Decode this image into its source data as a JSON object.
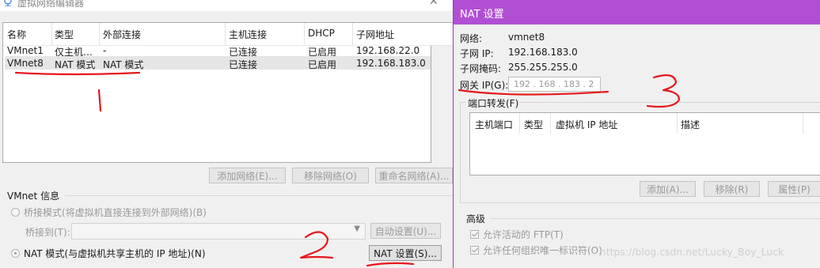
{
  "left_window": {
    "title": "虚拟网络编辑器",
    "table": {
      "columns": [
        "名称",
        "类型",
        "外部连接",
        "主机连接",
        "DHCP",
        "子网地址"
      ],
      "rows": [
        [
          "VMnet1",
          "仅主机…",
          "-",
          "已连接",
          "已启用",
          "192.168.22.0"
        ],
        [
          "VMnet8",
          "NAT 模式",
          "NAT 模式",
          "已连接",
          "已启用",
          "192.168.183.0"
        ]
      ],
      "selected_row": 1
    },
    "buttons": {
      "add": "添加网络(E)...",
      "remove": "移除网络(O)",
      "rename": "重命名网络(A)..."
    },
    "vmnet_info": {
      "section_label": "VMnet 信息",
      "bridged_radio": "桥接模式(将虚拟机直接连接到外部网络)(B)",
      "bridged_to_label": "桥接到(T):",
      "bridged_to_value": "",
      "auto_settings_button": "自动设置(U)...",
      "nat_radio": "NAT 模式(与虚拟机共享主机的 IP 地址)(N)",
      "nat_settings_button": "NAT 设置(S)..."
    }
  },
  "right_window": {
    "title": "NAT 设置",
    "network_label": "网络:",
    "network_value": "vmnet8",
    "subnet_ip_label": "子网 IP:",
    "subnet_ip_value": "192.168.183.0",
    "subnet_mask_label": "子网掩码:",
    "subnet_mask_value": "255.255.255.0",
    "gateway_label": "网关 IP(G):",
    "gateway_value": "192 . 168 . 183 . 2",
    "port_forwarding": {
      "group_label": "端口转发(F)",
      "columns": [
        "主机端口",
        "类型",
        "虚拟机 IP 地址",
        "描述"
      ],
      "add": "添加(A)...",
      "remove": "移除(R)",
      "properties": "属性(P)"
    },
    "advanced": {
      "group_label": "高级",
      "allow_ftp": "允许活动的 FTP(T)",
      "allow_any_oui": "允许任何组织唯一标识符(O)"
    }
  },
  "watermark": "https://blog.csdn.net/Lucky_Boy_Luck",
  "annotations": [
    "1",
    "2",
    "3"
  ],
  "colors": {
    "accent_title": "#b14fd4",
    "annotation_red": "#e4171d",
    "selected_row": "#e5e5e5"
  }
}
